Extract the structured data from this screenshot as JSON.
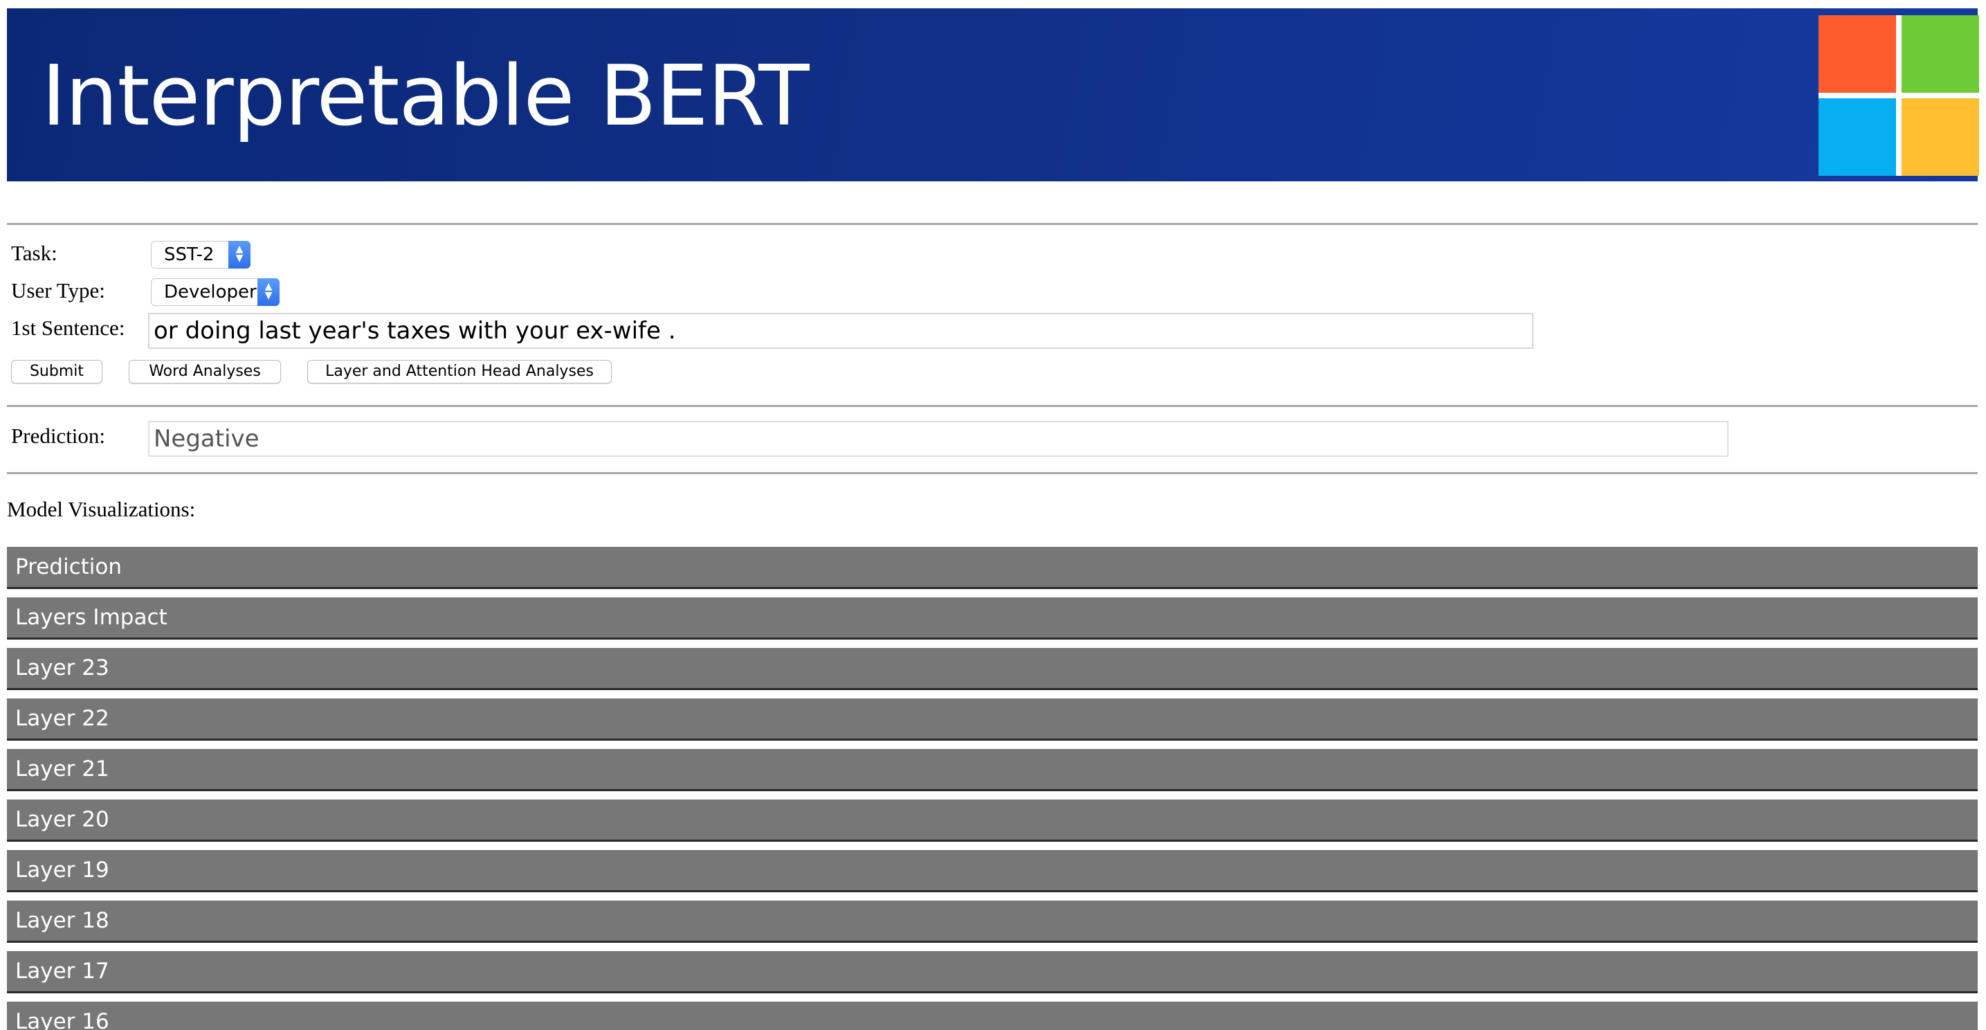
{
  "header": {
    "title": "Interpretable BERT",
    "logo_colors": {
      "red": "#ff5c2e",
      "green": "#6ccb36",
      "blue": "#08aff0",
      "yellow": "#ffbf31"
    }
  },
  "form": {
    "task_label": "Task:",
    "task_value": "SST-2",
    "user_type_label": "User Type:",
    "user_type_value": "Developer",
    "sentence_label": "1st Sentence:",
    "sentence_value": "or doing last year's taxes with your ex-wife .",
    "buttons": {
      "submit": "Submit",
      "word_analyses": "Word Analyses",
      "layer_head_analyses": "Layer and Attention Head Analyses"
    }
  },
  "prediction": {
    "label": "Prediction:",
    "value": "Negative"
  },
  "visualizations": {
    "heading": "Model Visualizations:",
    "items": [
      "Prediction",
      "Layers Impact",
      "Layer 23",
      "Layer 22",
      "Layer 21",
      "Layer 20",
      "Layer 19",
      "Layer 18",
      "Layer 17",
      "Layer 16"
    ]
  },
  "colors": {
    "header_bg": "#102f86",
    "accordion_bg": "#777777",
    "select_accent": "#2f6fe8"
  }
}
